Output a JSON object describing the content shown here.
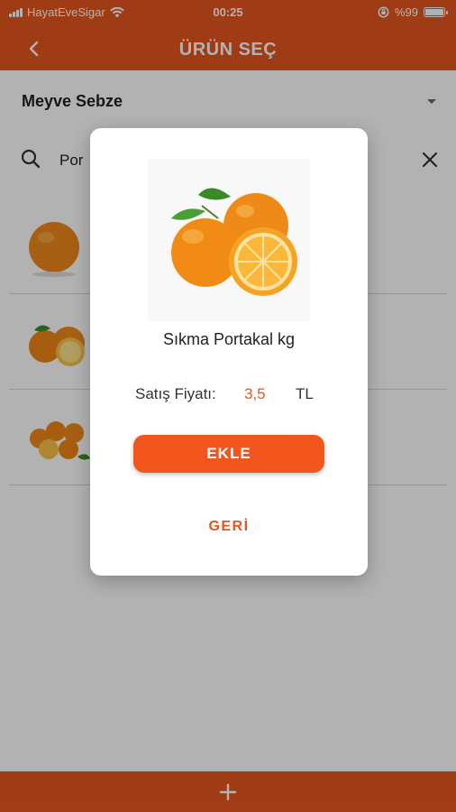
{
  "status_bar": {
    "carrier": "HayatEveSigar",
    "time": "00:25",
    "battery": "%99",
    "battery_level": 0.99
  },
  "header": {
    "title": "ÜRÜN SEÇ",
    "back_icon": "chevron-left-icon"
  },
  "category": {
    "selected": "Meyve Sebze",
    "dropdown_icon": "caret-down-icon"
  },
  "search": {
    "value": "Por",
    "search_icon": "search-icon",
    "clear_icon": "close-icon"
  },
  "dialog": {
    "product_name": "Sıkma Portakal kg",
    "price_label": "Satış Fiyatı:",
    "price_value": "3,5",
    "price_currency": "TL",
    "add_label": "EKLE",
    "back_label": "GERİ"
  },
  "bottom_bar": {
    "add_icon": "plus-icon"
  },
  "colors": {
    "brand": "#e5571f",
    "button": "#f2561c",
    "price": "#e5571f"
  }
}
